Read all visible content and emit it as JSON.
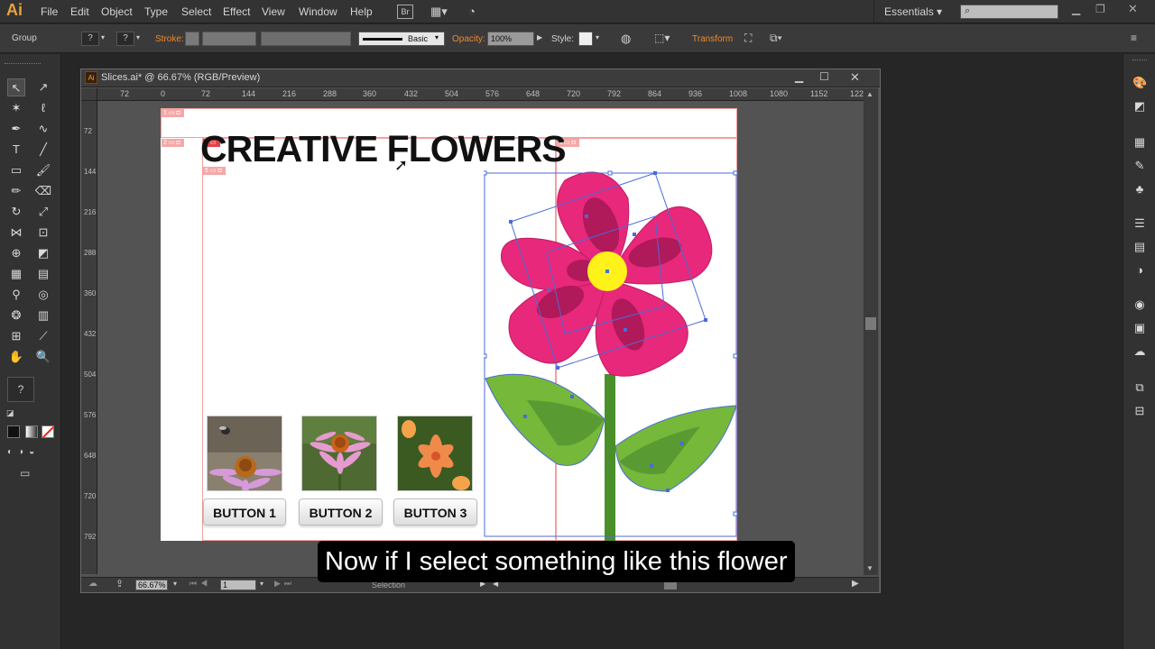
{
  "app": {
    "logo": "Ai",
    "workspace": "Essentials",
    "bridge_label": "Br"
  },
  "menu": [
    "File",
    "Edit",
    "Object",
    "Type",
    "Select",
    "Effect",
    "View",
    "Window",
    "Help"
  ],
  "control_bar": {
    "selection_type": "Group",
    "stroke_label": "Stroke:",
    "brush_label": "Basic",
    "opacity_label": "Opacity:",
    "opacity_value": "100%",
    "style_label": "Style:",
    "transform_label": "Transform"
  },
  "document": {
    "title": "Slices.ai* @ 66.67% (RGB/Preview)",
    "zoom": "66.67%",
    "artboard_number": "1",
    "status_tool": "Selection"
  },
  "ruler": {
    "h_ticks": [
      "72",
      "0",
      "72",
      "144",
      "216",
      "288",
      "360",
      "432",
      "504",
      "576",
      "648",
      "720",
      "792",
      "864",
      "936",
      "1008",
      "1080",
      "1152",
      "122"
    ],
    "v_ticks": [
      "72",
      "144",
      "216",
      "288",
      "360",
      "432",
      "504",
      "576",
      "648",
      "720",
      "792"
    ]
  },
  "artboard": {
    "headline": "CREATIVE FLOWERS",
    "buttons": [
      "BUTTON 1",
      "BUTTON 2",
      "BUTTON 3"
    ],
    "slice_tags": [
      "1",
      "2",
      "3",
      "4",
      "5"
    ],
    "colors": {
      "petal": "#e8287a",
      "petal_dark": "#b0195a",
      "center": "#fff21a",
      "leaf": "#76b83a",
      "stem": "#4a8f2a",
      "selection": "#4a6bd8"
    }
  },
  "caption": "Now if I select something like this flower"
}
